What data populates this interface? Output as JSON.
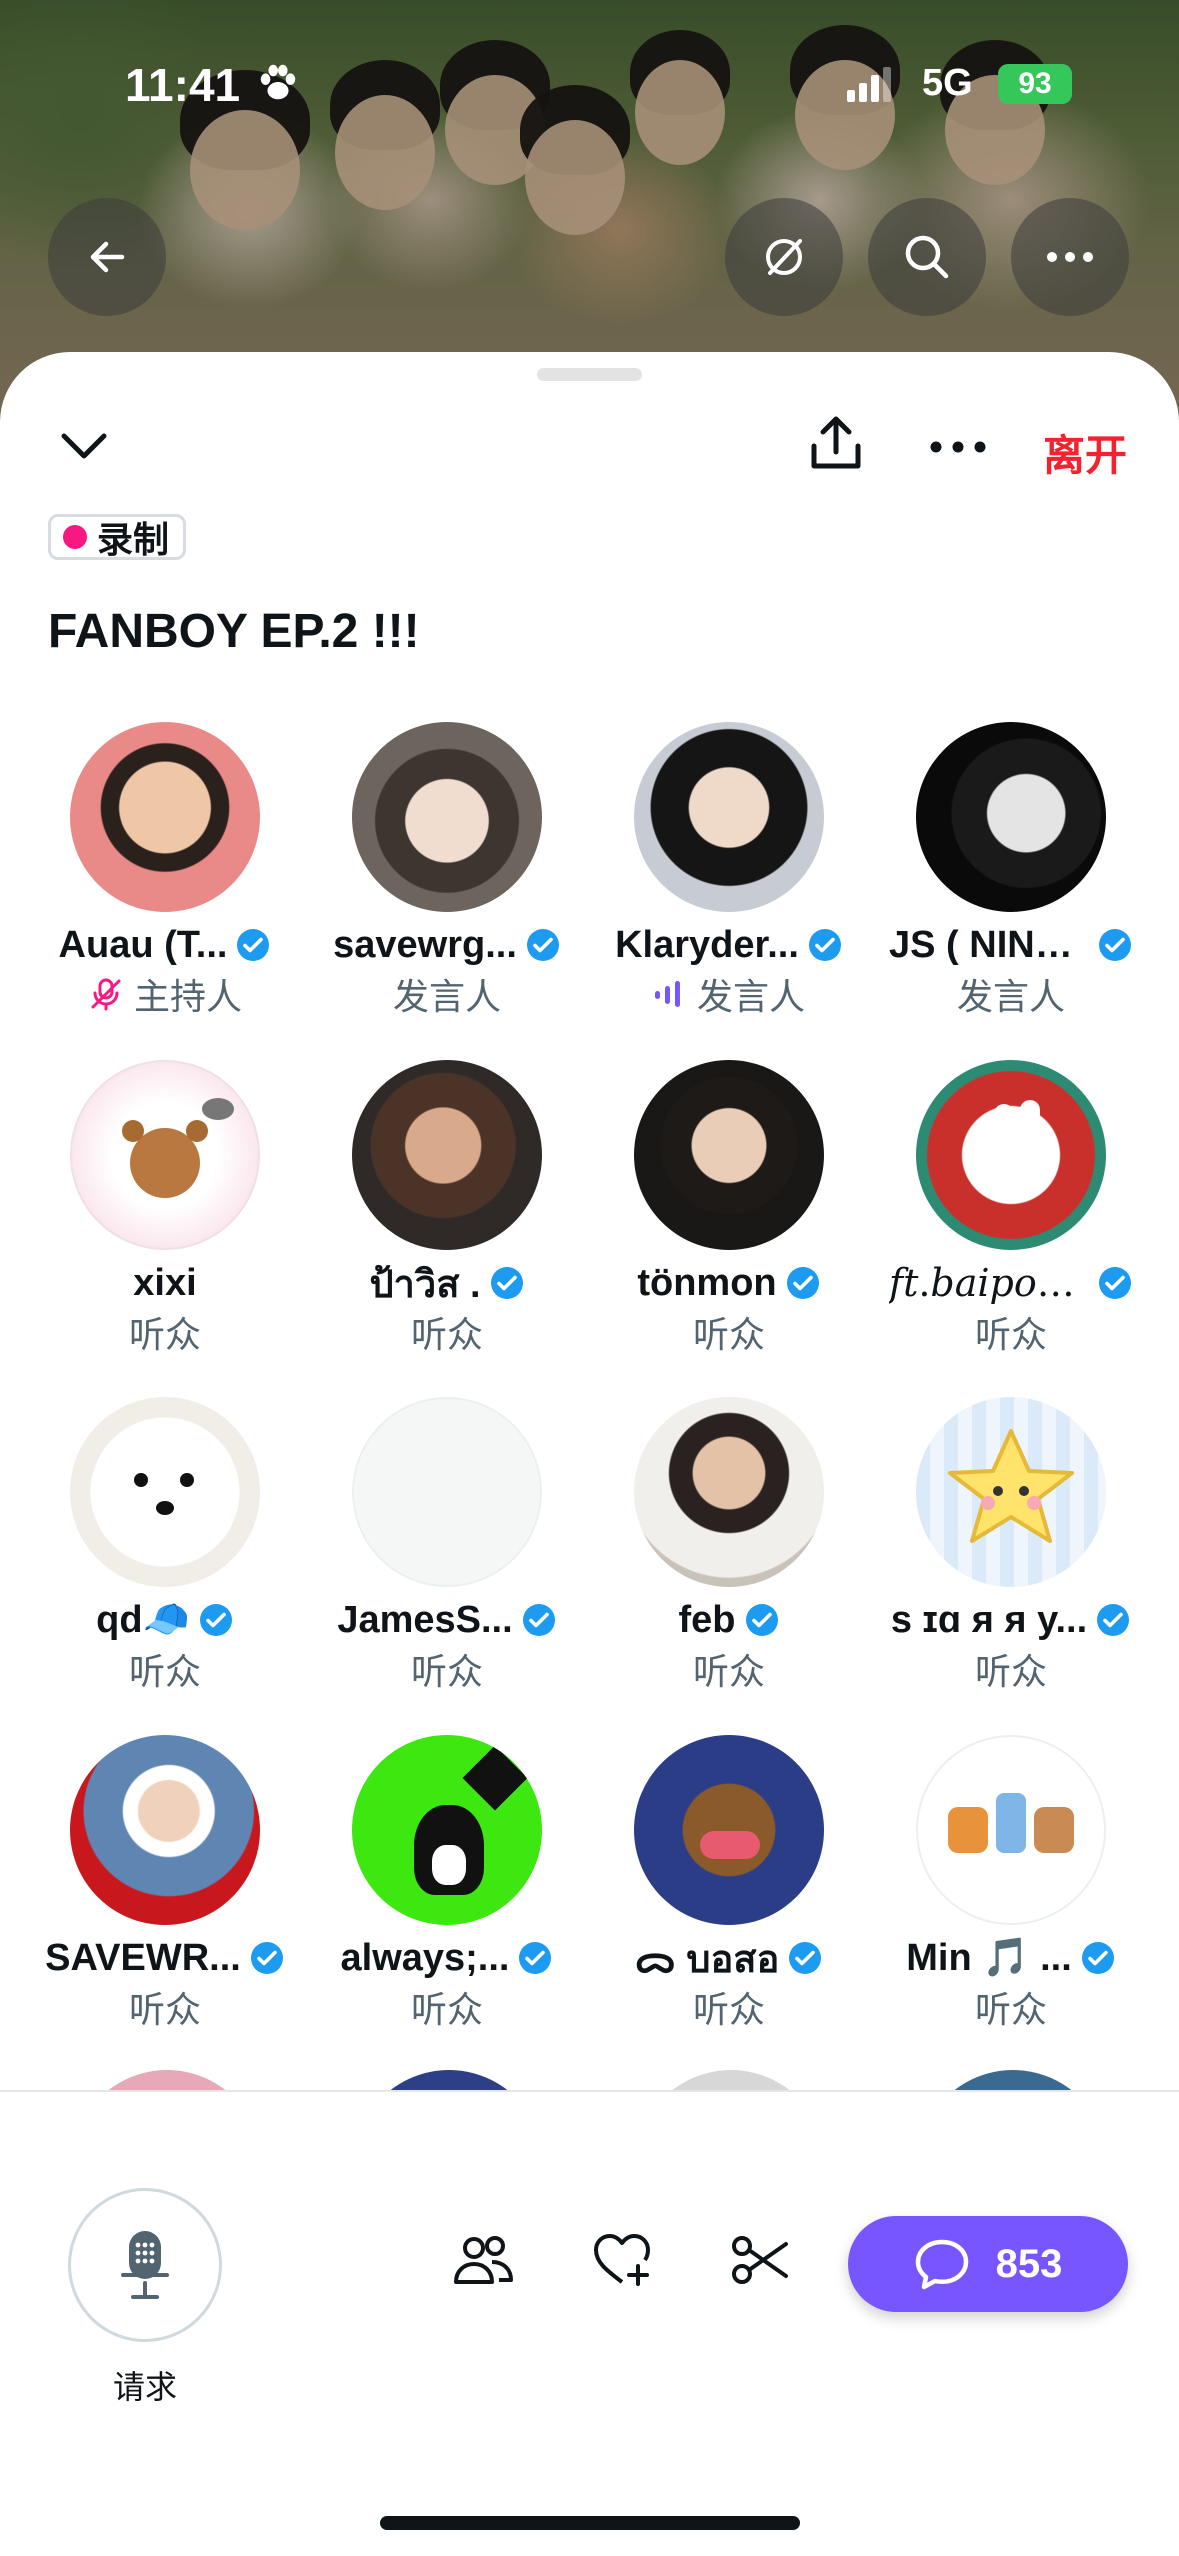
{
  "status_bar": {
    "time": "11:41",
    "network": "5G",
    "battery": "93"
  },
  "sheet": {
    "leave_label": "离开",
    "record_badge": "录制",
    "space_title": "FANBOY EP.2 !!!"
  },
  "participants": [
    {
      "name": "Auau (T...",
      "role": "主持人",
      "verified": true,
      "role_icon": "mic-muted-icon"
    },
    {
      "name": "savewrg...",
      "role": "发言人",
      "verified": true
    },
    {
      "name": "Klaryder...",
      "role": "发言人",
      "verified": true,
      "role_icon": "speaking-icon"
    },
    {
      "name": "JS ( NINE...",
      "role": "发言人",
      "verified": true
    },
    {
      "name": "xixi",
      "role": "听众",
      "verified": false
    },
    {
      "name": "ป้าวิส .",
      "role": "听众",
      "verified": true
    },
    {
      "name": "tönmon",
      "role": "听众",
      "verified": true
    },
    {
      "name": "𝑓𝑡.𝑏𝑎𝑖𝑝𝑜𝑟...",
      "role": "听众",
      "verified": true
    },
    {
      "name": "qd🧢",
      "role": "听众",
      "verified": true
    },
    {
      "name": "JamesS...",
      "role": "听众",
      "verified": true
    },
    {
      "name": "feb",
      "role": "听众",
      "verified": true
    },
    {
      "name": "s ɪɑ ᴙ ᴙ y...",
      "role": "听众",
      "verified": true
    },
    {
      "name": "SAVEWR...",
      "role": "听众",
      "verified": true
    },
    {
      "name": "always;...",
      "role": "听众",
      "verified": true
    },
    {
      "name": "ᯅ บอสอ",
      "role": "听众",
      "verified": true
    },
    {
      "name": "Min 🎵 ...",
      "role": "听众",
      "verified": true
    }
  ],
  "bottom_bar": {
    "request_label": "请求",
    "comment_count": "853"
  },
  "colors": {
    "accent": "#7856ff",
    "leave": "#f4212e",
    "verified": "#1d9bf0",
    "record": "#f91880"
  }
}
